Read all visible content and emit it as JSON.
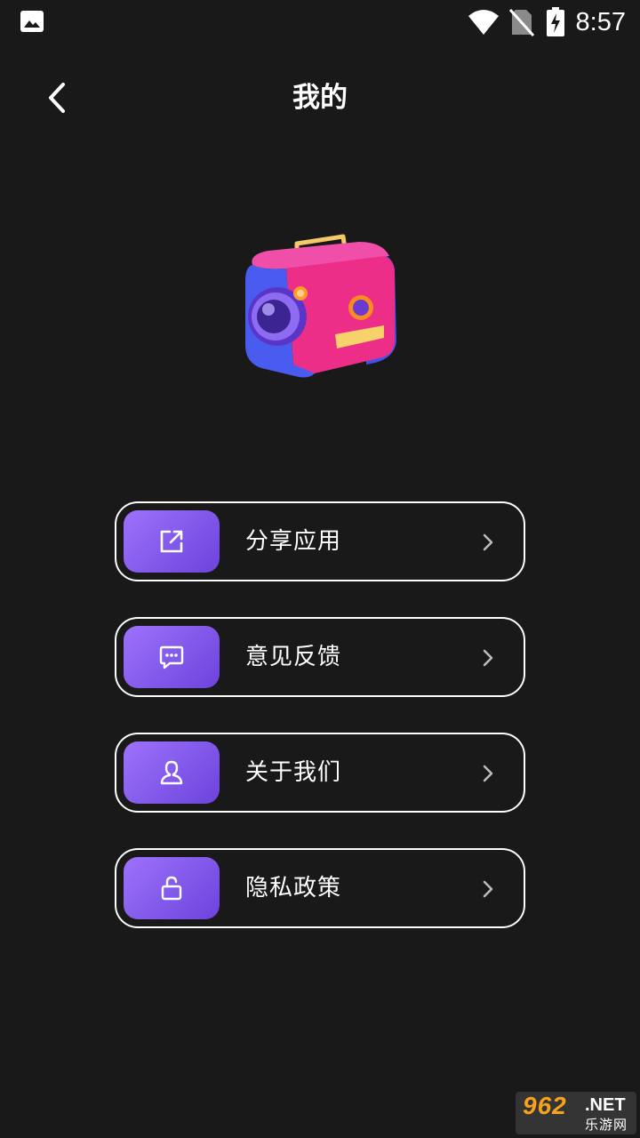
{
  "status_bar": {
    "time": "8:57",
    "icons": [
      "gallery-icon",
      "wifi-icon",
      "no-sim-icon",
      "battery-charging-icon"
    ]
  },
  "header": {
    "title": "我的",
    "back_icon": "chevron-left-icon"
  },
  "illustration": {
    "icon": "camera-3d-illustration"
  },
  "menu": {
    "items": [
      {
        "label": "分享应用",
        "icon": "share-external-icon"
      },
      {
        "label": "意见反馈",
        "icon": "chat-bubble-icon"
      },
      {
        "label": "关于我们",
        "icon": "user-icon"
      },
      {
        "label": "隐私政策",
        "icon": "unlock-icon"
      }
    ],
    "chevron_icon": "chevron-right-icon"
  },
  "watermark": {
    "main": "962",
    "net": ".NET",
    "sub": "乐游网"
  },
  "colors": {
    "background": "#191919",
    "accent_start": "#9d72fb",
    "accent_end": "#6c43dc",
    "watermark_orange": "#f6a21a"
  }
}
